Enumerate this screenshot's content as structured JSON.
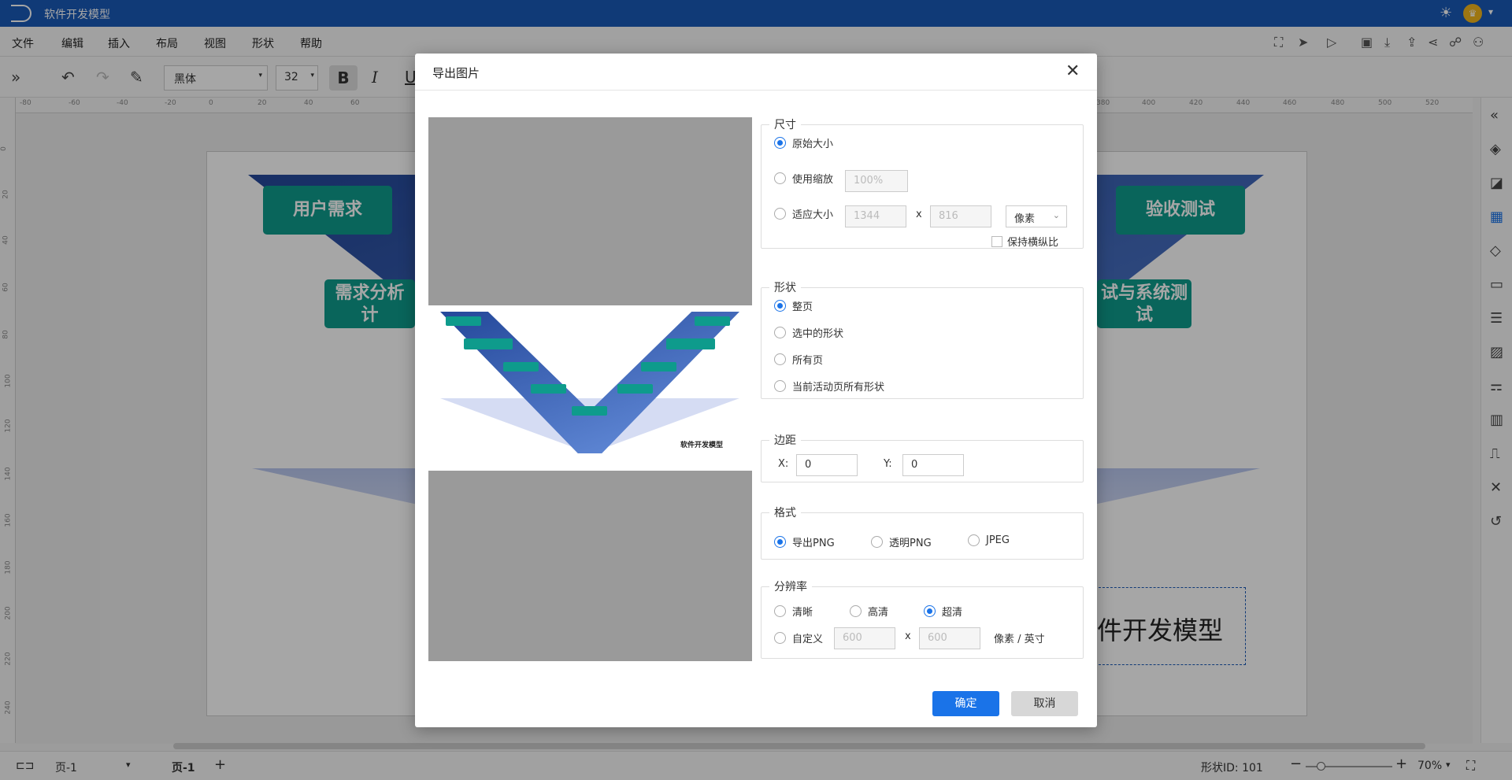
{
  "app": {
    "title": "软件开发模型",
    "crown_icon": "crown-icon"
  },
  "menu": [
    "文件",
    "编辑",
    "插入",
    "布局",
    "视图",
    "形状",
    "帮助"
  ],
  "toolbar": {
    "font": "黑体",
    "size": "32",
    "bold": "B",
    "italic": "I",
    "underline": "U"
  },
  "ruler": {
    "h": [
      "-80",
      "-60",
      "-40",
      "-20",
      "0",
      "20",
      "40",
      "60",
      "380",
      "400",
      "420",
      "440",
      "460",
      "480",
      "500",
      "520"
    ],
    "v": [
      "0",
      "20",
      "40",
      "60",
      "80",
      "100",
      "120",
      "140",
      "160",
      "180",
      "200",
      "220",
      "240"
    ]
  },
  "canvas": {
    "boxes": [
      "用户需求",
      "验收测试",
      "需求分析",
      "试与系统测"
    ],
    "boxes2": [
      "计",
      "试"
    ],
    "title": "件开发模型"
  },
  "status": {
    "page_sel": "页-1",
    "page_tab": "页-1",
    "add": "+",
    "shape_id": "形状ID: 101",
    "zoom": "70%"
  },
  "dialog": {
    "title": "导出图片",
    "size": {
      "legend": "尺寸",
      "original": "原始大小",
      "use_scale": "使用缩放",
      "scale_val": "100%",
      "fit": "适应大小",
      "w": "1344",
      "x": "x",
      "h": "816",
      "unit": "像素",
      "keep_ratio": "保持横纵比"
    },
    "shape": {
      "legend": "形状",
      "o1": "整页",
      "o2": "选中的形状",
      "o3": "所有页",
      "o4": "当前活动页所有形状"
    },
    "margin": {
      "legend": "边距",
      "xl": "X:",
      "xv": "0",
      "yl": "Y:",
      "yv": "0"
    },
    "format": {
      "legend": "格式",
      "o1": "导出PNG",
      "o2": "透明PNG",
      "o3": "JPEG"
    },
    "res": {
      "legend": "分辨率",
      "o1": "清晰",
      "o2": "高清",
      "o3": "超清",
      "o4": "自定义",
      "w": "600",
      "x": "x",
      "h": "600",
      "unit": "像素 / 英寸"
    },
    "preview_title": "软件开发模型",
    "ok": "确定",
    "cancel": "取消"
  },
  "colors": {
    "brand": "#1a59b7",
    "teal": "#0e9b8c",
    "accent": "#1a73e8"
  }
}
